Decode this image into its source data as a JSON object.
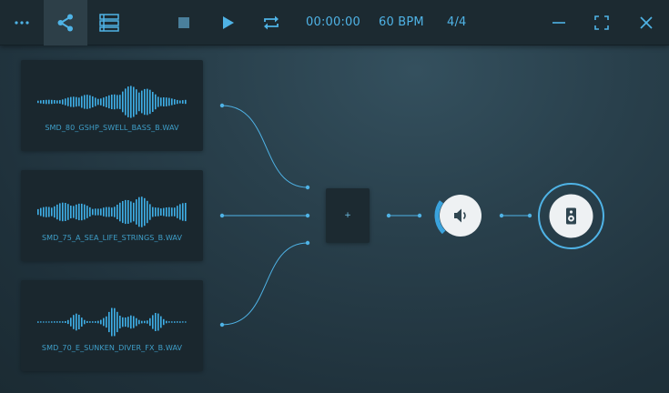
{
  "toolbar": {
    "buttons": [
      {
        "name": "more-button",
        "icon": "more-horizontal-icon"
      },
      {
        "name": "share-button",
        "icon": "share-icon",
        "active": true
      },
      {
        "name": "list-view-button",
        "icon": "list-icon"
      },
      {
        "name": "stop-button",
        "icon": "stop-icon"
      },
      {
        "name": "play-button",
        "icon": "play-icon"
      },
      {
        "name": "loop-button",
        "icon": "repeat-icon"
      },
      {
        "name": "minimize-button",
        "icon": "minimize-icon"
      },
      {
        "name": "fullscreen-button",
        "icon": "fullscreen-icon"
      },
      {
        "name": "close-button",
        "icon": "close-icon"
      }
    ],
    "time": "00:00:00",
    "tempo": "60 BPM",
    "time_signature": "4/4"
  },
  "clips": [
    {
      "name": "SMD_80_GSHP_SWELL_BASS_B.WAV"
    },
    {
      "name": "SMD_75_A_SEA_LIFE_STRINGS_B.WAV"
    },
    {
      "name": "SMD_70_E_SUNKEN_DIVER_FX_B.WAV"
    }
  ],
  "mixer": {
    "label": "+"
  },
  "volume": {
    "icon": "volume-icon",
    "level": 0.3
  },
  "output": {
    "icon": "speaker-icon"
  },
  "colors": {
    "accent": "#4fb3e6",
    "toolbar_bg": "#1c2a31",
    "clip_bg": "#1a272e",
    "knob_face": "#eef1f3"
  }
}
